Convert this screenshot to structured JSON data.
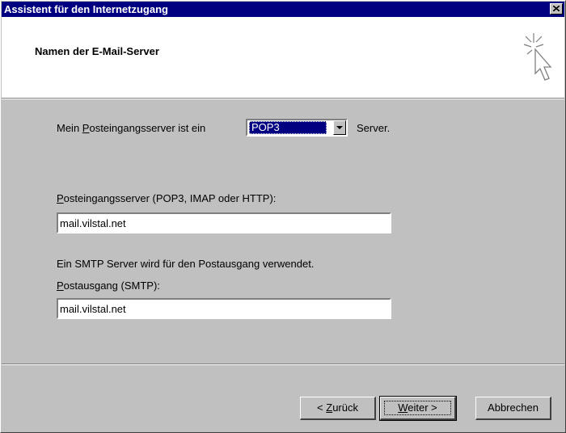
{
  "window": {
    "title": "Assistent für den Internetzugang"
  },
  "header": {
    "title": "Namen der E-Mail-Server"
  },
  "server_type": {
    "label_before": "Mein ",
    "label_accel": "P",
    "label_after": "osteingangsserver ist ein",
    "selected": "POP3",
    "suffix": "Server."
  },
  "incoming": {
    "label_accel": "P",
    "label_rest": "osteingangsserver (POP3, IMAP oder HTTP):",
    "value": "mail.vilstal.net"
  },
  "smtp_note": "Ein SMTP Server wird für den Postausgang verwendet.",
  "outgoing": {
    "label_accel": "P",
    "label_rest": "ostausgang (SMTP):",
    "value": "mail.vilstal.net"
  },
  "buttons": {
    "back_prefix": "< ",
    "back_accel": "Z",
    "back_rest": "urück",
    "next_accel": "W",
    "next_rest": "eiter >",
    "cancel": "Abbrechen"
  },
  "icons": {
    "close": "close-icon",
    "wizard": "wizard-cursor-icon",
    "dropdown": "chevron-down-icon"
  }
}
